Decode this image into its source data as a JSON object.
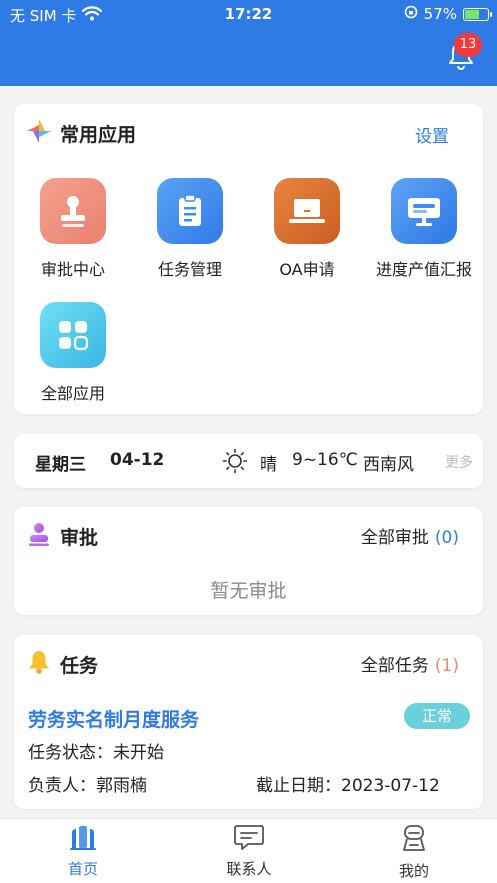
{
  "status_bar": {
    "carrier": "无 SIM 卡",
    "time": "17:22",
    "battery": "57%",
    "battery_level": 0.57
  },
  "header": {
    "notification_count": "13"
  },
  "common_apps": {
    "title": "常用应用",
    "settings_label": "设置",
    "apps": [
      {
        "label": "审批中心",
        "icon": "stamp-icon",
        "color": "#ef8f7c"
      },
      {
        "label": "任务管理",
        "icon": "clipboard-icon",
        "color": "#3f8ff0"
      },
      {
        "label": "OA申请",
        "icon": "laptop-icon",
        "color": "#d9702f"
      },
      {
        "label": "进度产值汇报",
        "icon": "monitor-icon",
        "color": "#3c8cf2"
      },
      {
        "label": "全部应用",
        "icon": "grid-icon",
        "color": "#4ec6e8"
      }
    ]
  },
  "weather": {
    "weekday": "星期三",
    "date": "04-12",
    "icon": "sun-icon",
    "condition": "晴",
    "temperature": "9~16℃",
    "wind": "西南风",
    "more_label": "更多"
  },
  "approval": {
    "title": "审批",
    "all_label": "全部审批",
    "count": "(0)",
    "empty_text": "暂无审批"
  },
  "task": {
    "title": "任务",
    "all_label": "全部任务",
    "count": "(1)",
    "item": {
      "title": "劳务实名制月度服务",
      "state_badge": "正常",
      "status_line": "任务状态：未开始",
      "owner_line": "负责人：郭雨楠",
      "deadline_line": "截止日期：2023-07-12"
    }
  },
  "tabbar": {
    "tabs": [
      {
        "label": "首页",
        "icon": "building-icon"
      },
      {
        "label": "联系人",
        "icon": "chat-icon"
      },
      {
        "label": "我的",
        "icon": "robot-icon"
      }
    ]
  }
}
